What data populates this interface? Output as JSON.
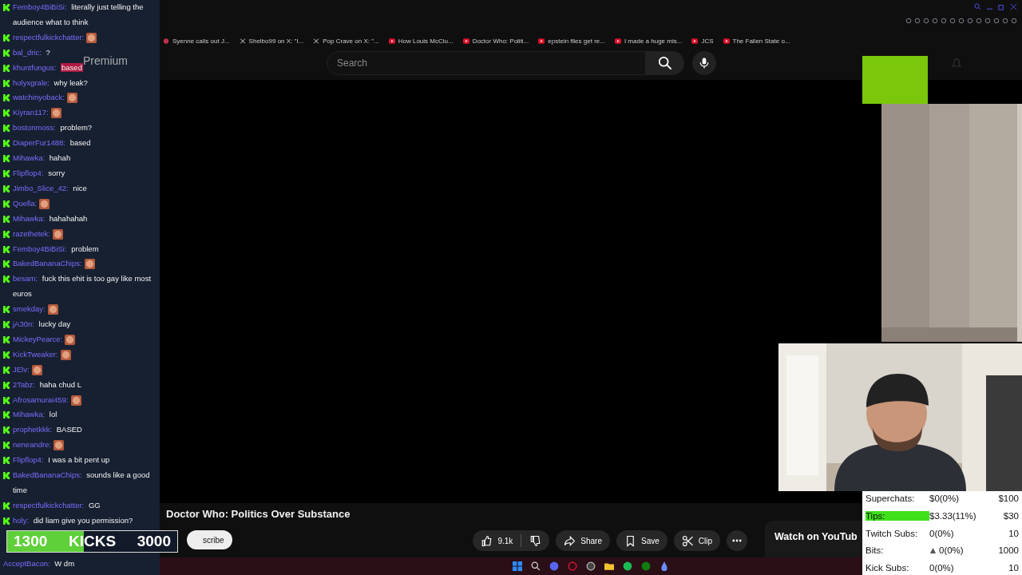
{
  "chat": {
    "messages": [
      {
        "user": "Femboy4BiBiSi:",
        "text": "literally just telling the audience what to think"
      },
      {
        "user": "respectfulkickchatter:",
        "emote": true
      },
      {
        "user": "bal_dric:",
        "text": "?"
      },
      {
        "user": "khuntfungus:",
        "text": "based",
        "highlight": true
      },
      {
        "user": "holyxgrale:",
        "text": "why leak?"
      },
      {
        "user": "watchinyoback:",
        "emote": true
      },
      {
        "user": "Kiyran117:",
        "emote": true
      },
      {
        "user": "bostonmoss:",
        "text": "problem?"
      },
      {
        "user": "DiaperFur1488:",
        "text": "based"
      },
      {
        "user": "Mihawka:",
        "text": "hahah"
      },
      {
        "user": "Flipflop4:",
        "text": "sorry"
      },
      {
        "user": "Jimbo_Slice_42:",
        "text": "nice"
      },
      {
        "user": "Quella:",
        "emote": true
      },
      {
        "user": "Mihawka:",
        "text": "hahahahah"
      },
      {
        "user": "razethetek:",
        "emote": true
      },
      {
        "user": "Femboy4BiBiSi:",
        "text": "problem"
      },
      {
        "user": "BakedBananaChips:",
        "emote": true
      },
      {
        "user": "besam:",
        "text": "fuck this ehit is too gay like most euros"
      },
      {
        "user": "smekday:",
        "emote": true
      },
      {
        "user": "jA30n:",
        "text": "lucky day"
      },
      {
        "user": "MickeyPearce:",
        "emote": true
      },
      {
        "user": "KickTweaker:",
        "emote": true
      },
      {
        "user": "JElv:",
        "emote": true
      },
      {
        "user": "2Tabz:",
        "text": "haha chud L"
      },
      {
        "user": "Afrosamurai459:",
        "emote": true
      },
      {
        "user": "Mihawka:",
        "text": "lol"
      },
      {
        "user": "prophetkkk:",
        "text": "BASED"
      },
      {
        "user": "neneandre:",
        "emote": true
      },
      {
        "user": "Flipflop4:",
        "text": "I was a bit pent up"
      },
      {
        "user": "BakedBananaChips:",
        "text": "sounds like a good time"
      },
      {
        "user": "respectfulkickchatter:",
        "text": "GG"
      },
      {
        "user": "holy:",
        "text": "did liam give you permission?"
      }
    ],
    "last_message": {
      "user": "AcceptBacon:",
      "text": "W dm"
    }
  },
  "logo_text": "Premium",
  "bookmarks": [
    {
      "kind": "site",
      "label": "Syenne calls out J..."
    },
    {
      "kind": "x",
      "label": "Shelbo99 on X: \"I..."
    },
    {
      "kind": "x",
      "label": "Pop Crave on X: \"..."
    },
    {
      "kind": "video",
      "label": "How Louis McClu..."
    },
    {
      "kind": "video",
      "label": "Doctor Who: Politi..."
    },
    {
      "kind": "video",
      "label": "epstein files get re..."
    },
    {
      "kind": "video",
      "label": "I made a huge mis..."
    },
    {
      "kind": "video",
      "label": "JCS"
    },
    {
      "kind": "video",
      "label": "The Fallen State o..."
    }
  ],
  "search": {
    "placeholder": "Search"
  },
  "video": {
    "title": "Doctor Who: Politics Over Substance",
    "likes": "9.1k",
    "actions": [
      "Share",
      "Save",
      "Clip"
    ],
    "subscribe": "scribe"
  },
  "side_heading": "Watch on YouTub",
  "kicks_goal": {
    "current": "1300",
    "label": "KICKS",
    "target": "3000",
    "level": 0.45
  },
  "stats": [
    {
      "label": "Superchats:",
      "value": "$0(0%)",
      "goal": "$100",
      "highlight": false
    },
    {
      "label": "Tips:",
      "value": "$3.33(11%)",
      "goal": "$30",
      "highlight": true
    },
    {
      "label": "Twitch Subs:",
      "value": "0(0%)",
      "goal": "10",
      "highlight": false
    },
    {
      "label": "Bits:",
      "value": "0(0%)",
      "goal": "1000",
      "highlight": false,
      "icon": true
    },
    {
      "label": "Kick Subs:",
      "value": "0(0%)",
      "goal": "10",
      "highlight": false
    }
  ]
}
